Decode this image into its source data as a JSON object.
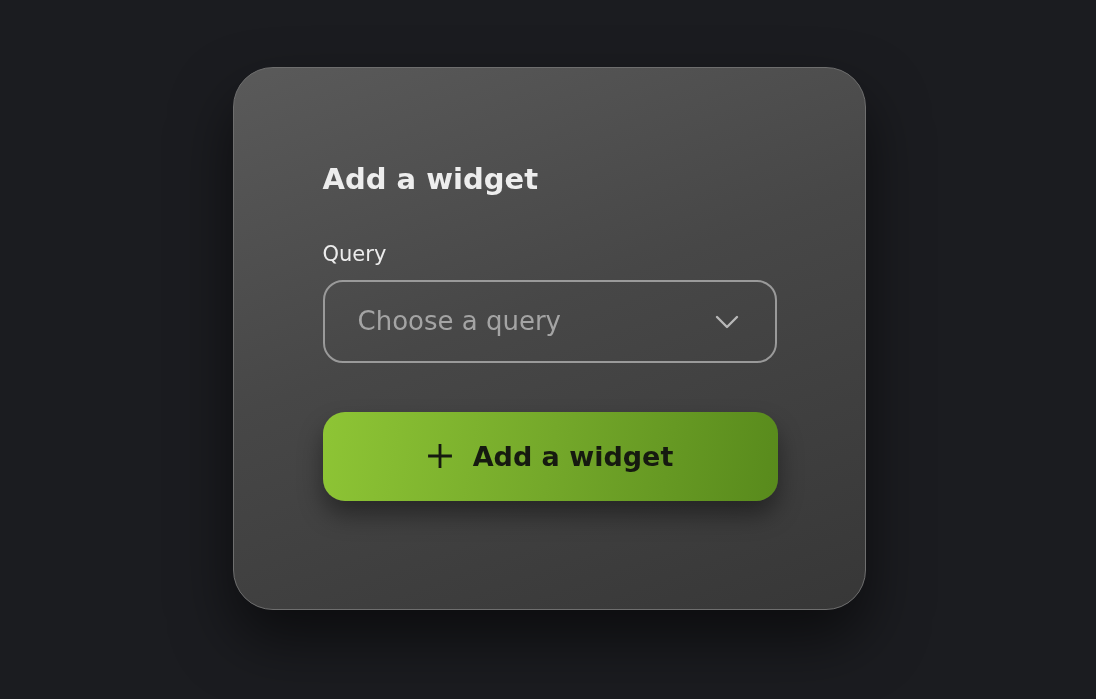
{
  "card": {
    "title": "Add a widget",
    "query_field": {
      "label": "Query",
      "placeholder": "Choose a query"
    },
    "button": {
      "label": "Add a widget"
    }
  }
}
